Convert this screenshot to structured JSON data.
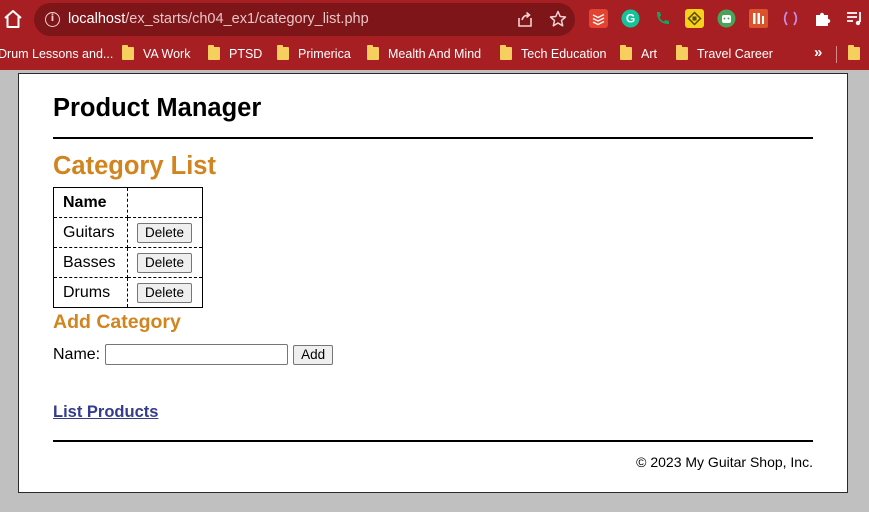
{
  "browser": {
    "url_host": "localhost",
    "url_path": "/ex_starts/ch04_ex1/category_list.php",
    "extension_icons": [
      "todoist-icon",
      "grammarly-icon",
      "phone-icon",
      "qr-icon",
      "robot-icon",
      "bar-icon",
      "brackets-icon",
      "puzzle-icon",
      "reading-list-icon"
    ],
    "bookmarks": [
      {
        "label": "Drum Lessons and..."
      },
      {
        "label": "VA Work"
      },
      {
        "label": "PTSD"
      },
      {
        "label": "Primerica"
      },
      {
        "label": "Mealth And Mind"
      },
      {
        "label": "Tech Education"
      },
      {
        "label": "Art"
      },
      {
        "label": "Travel Career"
      }
    ],
    "more_label": "»"
  },
  "page": {
    "app_title": "Product Manager",
    "section_title": "Category List",
    "table": {
      "header": "Name",
      "rows": [
        {
          "name": "Guitars",
          "action": "Delete"
        },
        {
          "name": "Basses",
          "action": "Delete"
        },
        {
          "name": "Drums",
          "action": "Delete"
        }
      ]
    },
    "add_title": "Add Category",
    "name_label": "Name:",
    "name_value": "",
    "add_button": "Add",
    "list_link": "List Products",
    "footer": "© 2023 My Guitar Shop, Inc."
  },
  "colors": {
    "chrome": "#a81f23",
    "omnibox": "#7e1519",
    "heading_accent": "#d2841e",
    "link": "#353c8c"
  }
}
